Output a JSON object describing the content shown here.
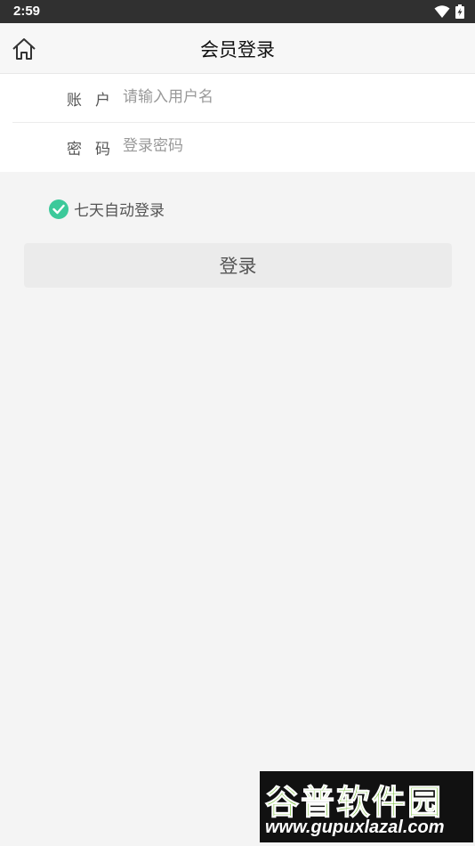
{
  "status_bar": {
    "time": "2:59",
    "icons": [
      "wifi-icon",
      "battery-charging-icon"
    ]
  },
  "header": {
    "title": "会员登录",
    "home_icon": "home-icon"
  },
  "form": {
    "account": {
      "label": "账户",
      "placeholder": "请输入用户名",
      "value": ""
    },
    "password": {
      "label": "密码",
      "placeholder": "登录密码",
      "value": ""
    }
  },
  "remember": {
    "label": "七天自动登录",
    "checked": true,
    "check_color": "#3cc99a"
  },
  "login_button": {
    "label": "登录"
  },
  "watermark": {
    "line1": "谷普软件园",
    "line2": "www.gupuxlazal.com"
  },
  "colors": {
    "background": "#f4f4f4",
    "accent": "#3cc99a",
    "button_bg": "#ebebeb"
  }
}
